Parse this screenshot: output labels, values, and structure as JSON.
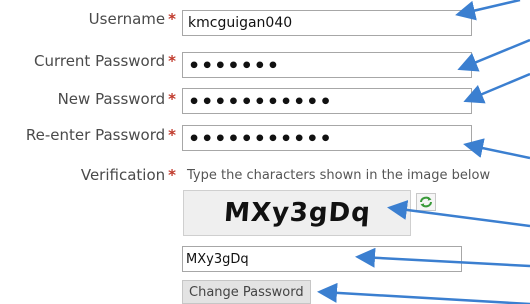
{
  "form": {
    "username": {
      "label": "Username",
      "required_mark": "*",
      "value": "kmcguigan040"
    },
    "current_password": {
      "label": "Current Password",
      "required_mark": "*",
      "value": "•••••••"
    },
    "new_password": {
      "label": "New Password",
      "required_mark": "*",
      "value": "•••••••••••"
    },
    "reenter_password": {
      "label": "Re-enter Password",
      "required_mark": "*",
      "value": "•••••••••••"
    },
    "verification": {
      "label": "Verification",
      "required_mark": "*",
      "hint": "Type the characters shown in the image below",
      "captcha_text": "MXy3gDq",
      "refresh_icon": "refresh-icon",
      "input_value": "MXy3gDq"
    },
    "submit_label": "Change Password"
  },
  "colors": {
    "required": "#c0392b",
    "annotation_arrow": "#3b7fd0",
    "field_border": "#a7a7a7",
    "button_bg": "#e3e3e3"
  }
}
